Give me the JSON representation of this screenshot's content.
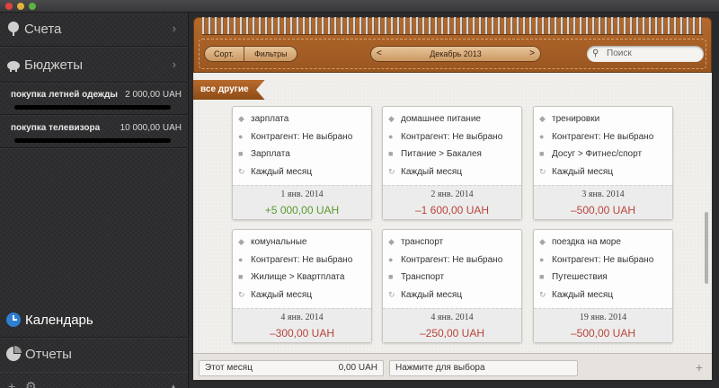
{
  "sidebar": {
    "accounts_label": "Счета",
    "budgets_label": "Бюджеты",
    "budget_items": [
      {
        "name": "покупка летней одежды",
        "amount": "2 000,00 UAH"
      },
      {
        "name": "покупка телевизора",
        "amount": "10 000,00 UAH"
      }
    ],
    "calendar_label": "Календарь",
    "reports_label": "Отчеты",
    "footer": {
      "add": "+",
      "settings": "⚙",
      "menu": "▲"
    }
  },
  "toolbar": {
    "sort_label": "Сорт.",
    "filters_label": "Фильтры",
    "prev": "<",
    "next": ">",
    "month": "Декабрь 2013",
    "search_placeholder": "Поиск"
  },
  "category_ribbon": "все другие",
  "cards": [
    {
      "title": "зарплата",
      "counterparty": "Контрагент: Не выбрано",
      "category": "Зарплата",
      "repeat": "Каждый месяц",
      "date": "1 янв. 2014",
      "amount": "+5 000,00 UAH",
      "sign": "pos"
    },
    {
      "title": "домашнее питание",
      "counterparty": "Контрагент: Не выбрано",
      "category": "Питание > Бакалея",
      "repeat": "Каждый месяц",
      "date": "2 янв. 2014",
      "amount": "–1 600,00 UAH",
      "sign": "neg"
    },
    {
      "title": "тренировки",
      "counterparty": "Контрагент: Не выбрано",
      "category": "Досуг > Фитнес/спорт",
      "repeat": "Каждый месяц",
      "date": "3 янв. 2014",
      "amount": "–500,00 UAH",
      "sign": "neg"
    },
    {
      "title": "комунальные",
      "counterparty": "Контрагент: Не выбрано",
      "category": "Жилище > Квартплата",
      "repeat": "Каждый месяц",
      "date": "4 янв. 2014",
      "amount": "–300,00 UAH",
      "sign": "neg"
    },
    {
      "title": "транспорт",
      "counterparty": "Контрагент: Не выбрано",
      "category": "Транспорт",
      "repeat": "Каждый месяц",
      "date": "4 янв. 2014",
      "amount": "–250,00 UAH",
      "sign": "neg"
    },
    {
      "title": "поездка на море",
      "counterparty": "Контрагент: Не выбрано",
      "category": "Путешествия",
      "repeat": "Каждый месяц",
      "date": "19 янв. 2014",
      "amount": "–500,00 UAH",
      "sign": "neg"
    }
  ],
  "bottom_bar": {
    "period_label": "Этот месяц",
    "period_amount": "0,00 UAH",
    "select_hint": "Нажмите для выбора",
    "add": "+"
  },
  "colors": {
    "positive": "#5a9a2e",
    "negative": "#b8433a",
    "leather": "#a65e24"
  }
}
